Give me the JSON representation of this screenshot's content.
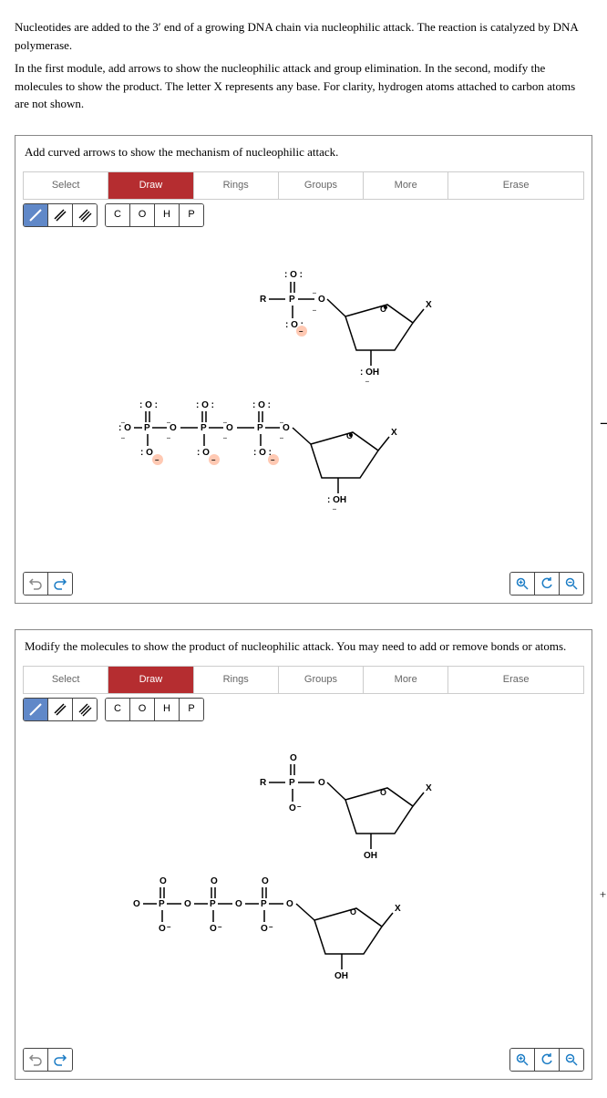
{
  "intro": {
    "p1": "Nucleotides are added to the 3′ end of a growing DNA chain via nucleophilic attack. The reaction is catalyzed by DNA polymerase.",
    "p2": "In the first module, add arrows to show the nucleophilic attack and group elimination. In the second, modify the molecules to show the product. The letter X represents any base. For clarity, hydrogen atoms attached to carbon atoms are not shown."
  },
  "panel1": {
    "title": "Add curved arrows to show the mechanism of nucleophilic attack."
  },
  "panel2": {
    "title": "Modify the molecules to show the product of nucleophilic attack. You may need to add or remove bonds or atoms."
  },
  "tabs": {
    "select": "Select",
    "draw": "Draw",
    "rings": "Rings",
    "groups": "Groups",
    "more": "More",
    "erase": "Erase"
  },
  "atoms": {
    "c": "C",
    "o": "O",
    "h": "H",
    "p": "P"
  },
  "side": {
    "arrow": "→",
    "ppi": "+ PPᵢ"
  },
  "mol": {
    "O": "O",
    "P": "P",
    "R": "R",
    "X": "X",
    "OH": "OH",
    "minus": "–"
  }
}
